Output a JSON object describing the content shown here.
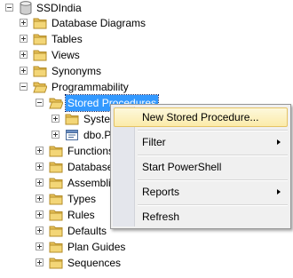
{
  "tree": {
    "root": "SSDIndia",
    "db_diagrams": "Database Diagrams",
    "tables": "Tables",
    "views": "Views",
    "synonyms": "Synonyms",
    "programmability": "Programmability",
    "stored_procedures": "Stored Procedures",
    "system_sp": "System Stored Procedures",
    "dbo_sp": "dbo.Procedure",
    "functions": "Functions",
    "db_triggers": "Database Triggers",
    "assemblies": "Assemblies",
    "types": "Types",
    "rules": "Rules",
    "defaults": "Defaults",
    "plan_guides": "Plan Guides",
    "sequences": "Sequences"
  },
  "menu": {
    "new_sp": "New Stored Procedure...",
    "filter": "Filter",
    "start_ps": "Start PowerShell",
    "reports": "Reports",
    "refresh": "Refresh"
  },
  "colors": {
    "selection": "#3399ff",
    "folder": "#e8c25a",
    "hover": "#fbeba9"
  }
}
